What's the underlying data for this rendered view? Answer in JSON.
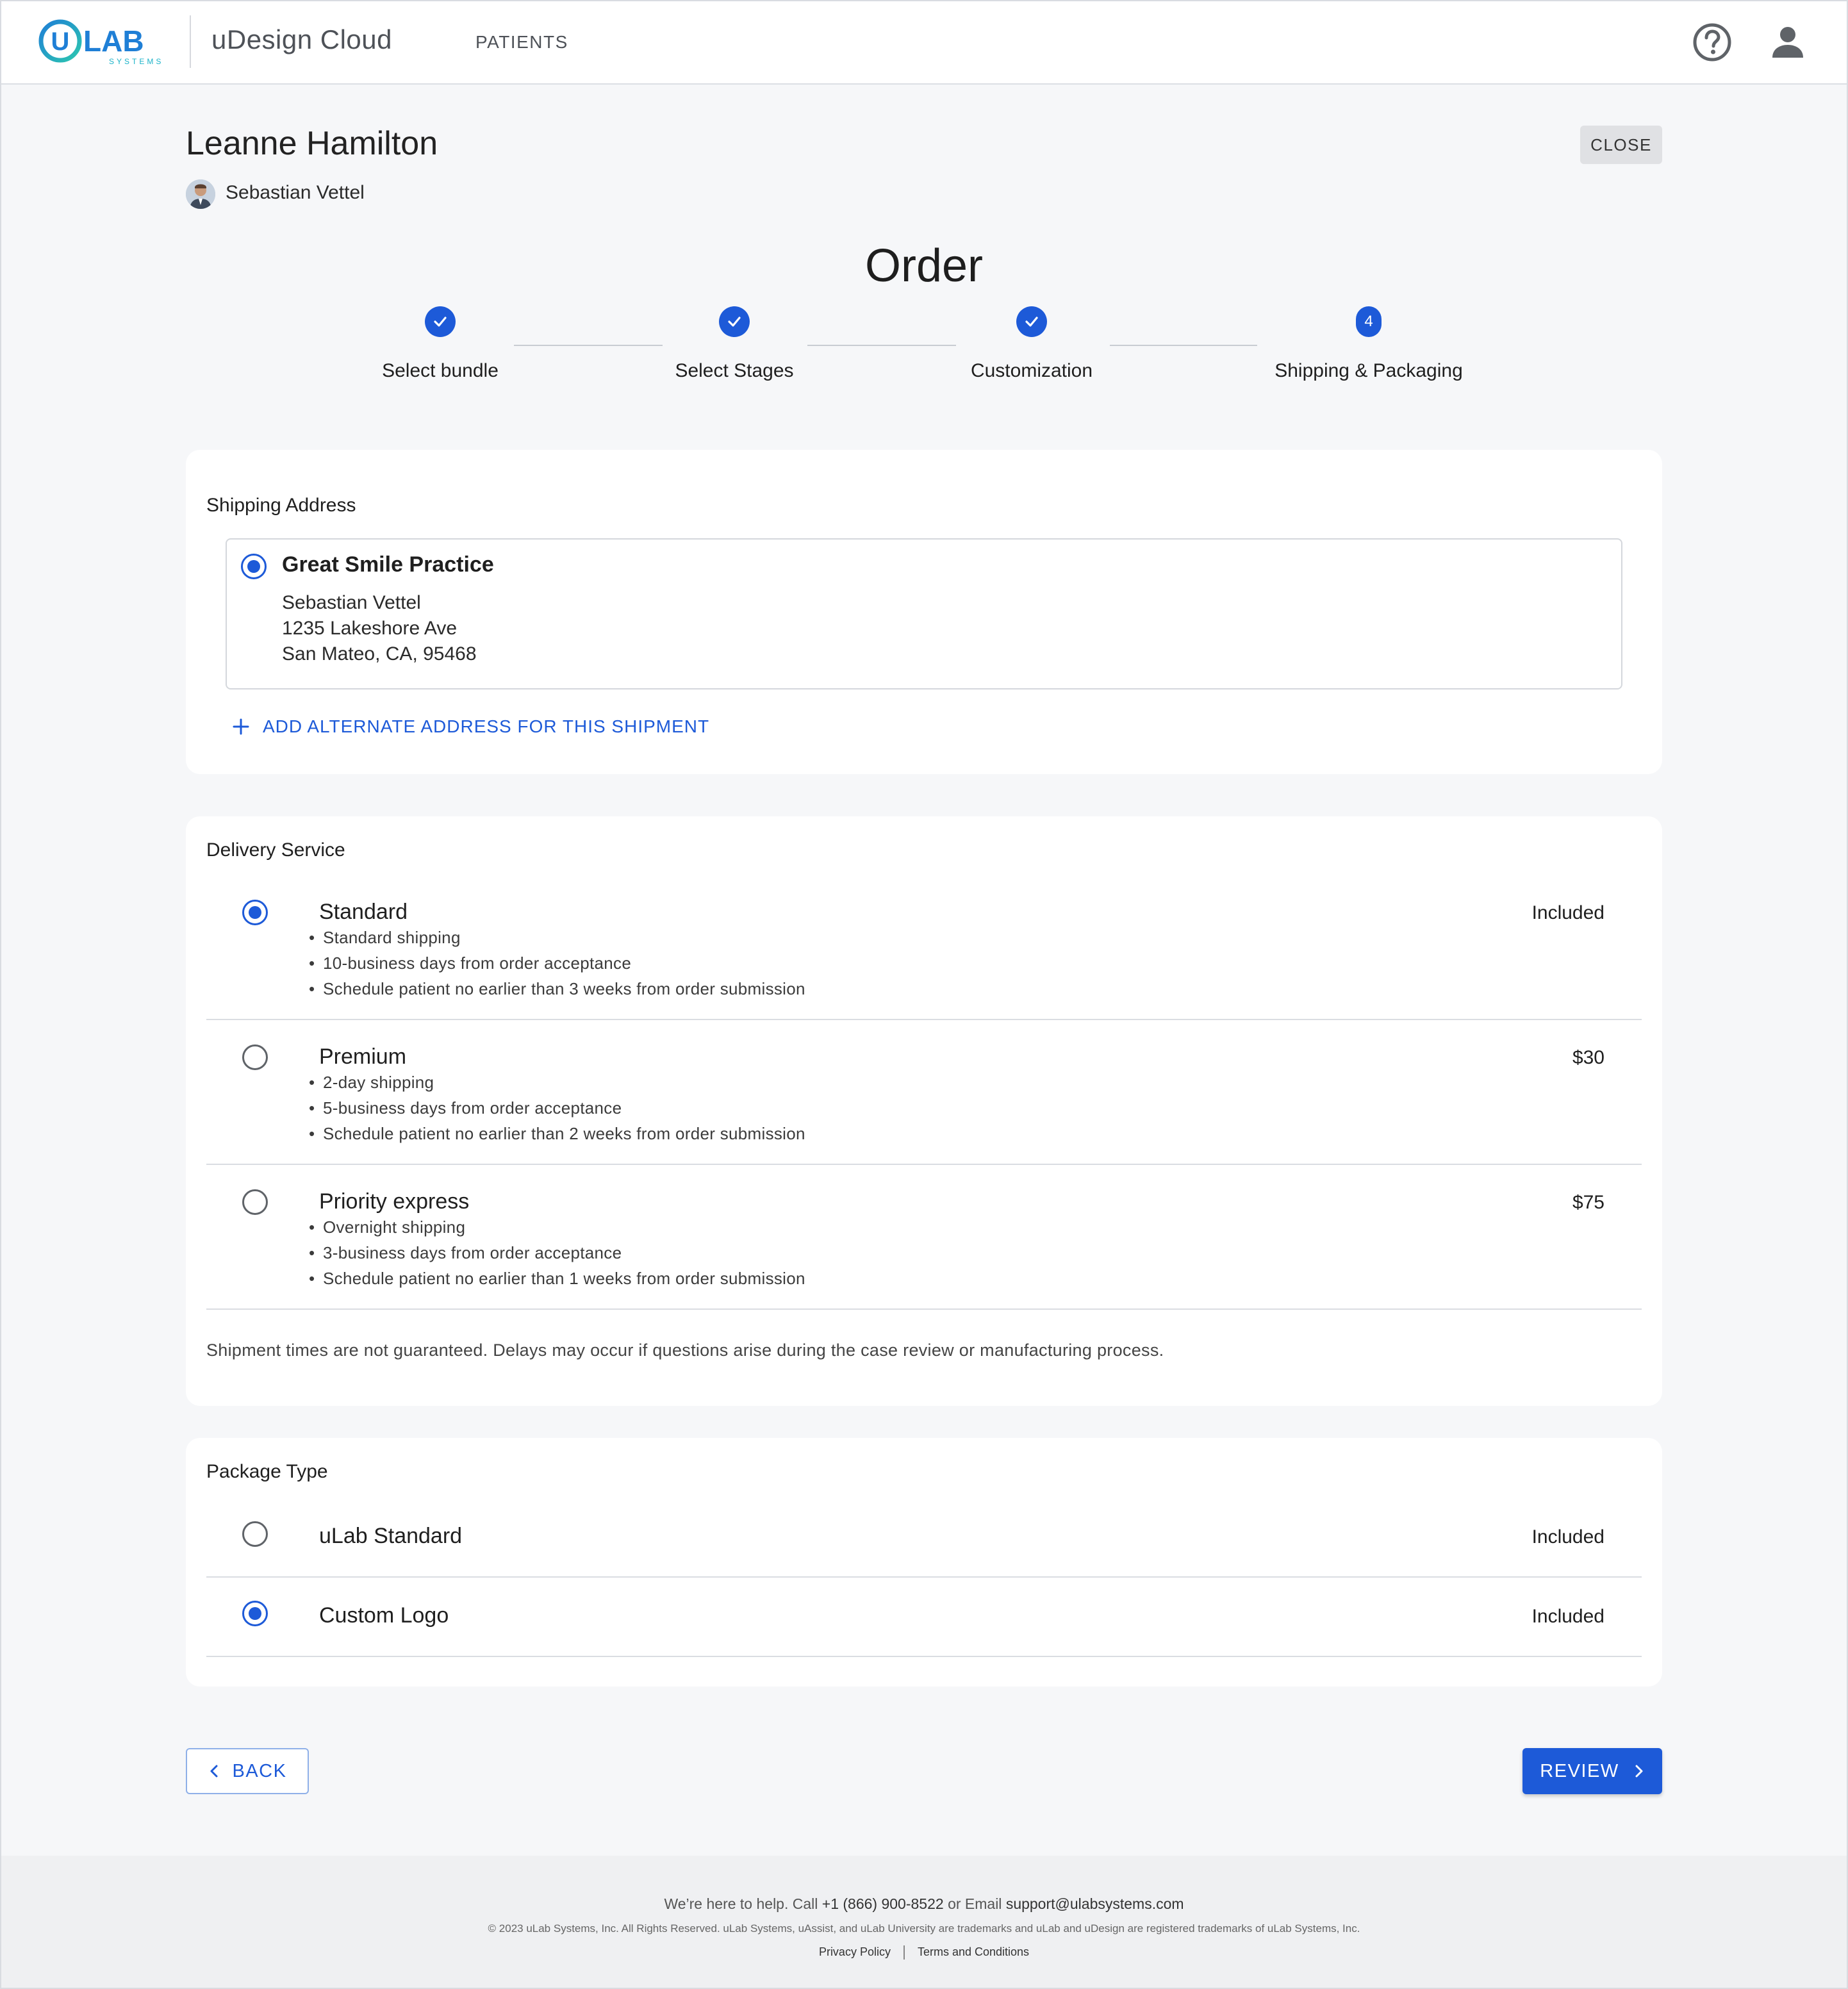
{
  "header": {
    "logo_text": "ULAB",
    "logo_subtext": "SYSTEMS",
    "app_title": "uDesign Cloud",
    "nav_patients": "PATIENTS"
  },
  "patient": {
    "name": "Leanne Hamilton",
    "doctor": "Sebastian Vettel",
    "close_label": "CLOSE"
  },
  "order": {
    "title": "Order",
    "steps": [
      {
        "label": "Select bundle",
        "state": "complete"
      },
      {
        "label": "Select Stages",
        "state": "complete"
      },
      {
        "label": "Customization",
        "state": "complete"
      },
      {
        "label": "Shipping & Packaging",
        "state": "active",
        "number": "4"
      }
    ]
  },
  "shipping": {
    "title": "Shipping Address",
    "address": {
      "practice": "Great Smile Practice",
      "line1": "Sebastian Vettel",
      "line2": "1235 Lakeshore Ave",
      "line3": "San Mateo, CA, 95468",
      "selected": true
    },
    "add_alt_label": "ADD ALTERNATE ADDRESS FOR THIS SHIPMENT"
  },
  "delivery": {
    "title": "Delivery Service",
    "options": [
      {
        "name": "Standard",
        "price": "Included",
        "selected": true,
        "bullets": [
          "Standard shipping",
          "10-business days from order acceptance",
          "Schedule patient no earlier than 3 weeks from order submission"
        ]
      },
      {
        "name": "Premium",
        "price": "$30",
        "selected": false,
        "bullets": [
          "2-day shipping",
          "5-business days from order acceptance",
          "Schedule patient no earlier than 2 weeks from order submission"
        ]
      },
      {
        "name": "Priority express",
        "price": "$75",
        "selected": false,
        "bullets": [
          "Overnight shipping",
          "3-business days from order acceptance",
          "Schedule patient no earlier than 1 weeks from order submission"
        ]
      }
    ],
    "disclaimer": "Shipment times are not guaranteed. Delays may occur if questions arise during the case review or manufacturing process."
  },
  "package": {
    "title": "Package Type",
    "options": [
      {
        "name": "uLab Standard",
        "price": "Included",
        "selected": false
      },
      {
        "name": "Custom Logo",
        "price": "Included",
        "selected": true
      }
    ]
  },
  "actions": {
    "back_label": "BACK",
    "review_label": "REVIEW"
  },
  "footer": {
    "help_prefix": "We’re here to help. Call",
    "phone": "+1 (866) 900-8522",
    "help_mid": "or Email",
    "email": "support@ulabsystems.com",
    "copyright": "© 2023 uLab Systems, Inc. All Rights Reserved. uLab Systems, uAssist, and uLab University are trademarks and uLab and uDesign are registered trademarks of uLab Systems, Inc.",
    "privacy": "Privacy Policy",
    "terms": "Terms and Conditions"
  },
  "colors": {
    "accent": "#1d5ad8",
    "logo_teal": "#1bb3c9",
    "background": "#f6f7f9",
    "card": "#ffffff"
  },
  "icons": {
    "help": "help-circle-icon",
    "user": "user-account-icon",
    "check": "check-icon",
    "plus": "plus-icon",
    "chevron_left": "chevron-left-icon",
    "chevron_right": "chevron-right-icon"
  }
}
